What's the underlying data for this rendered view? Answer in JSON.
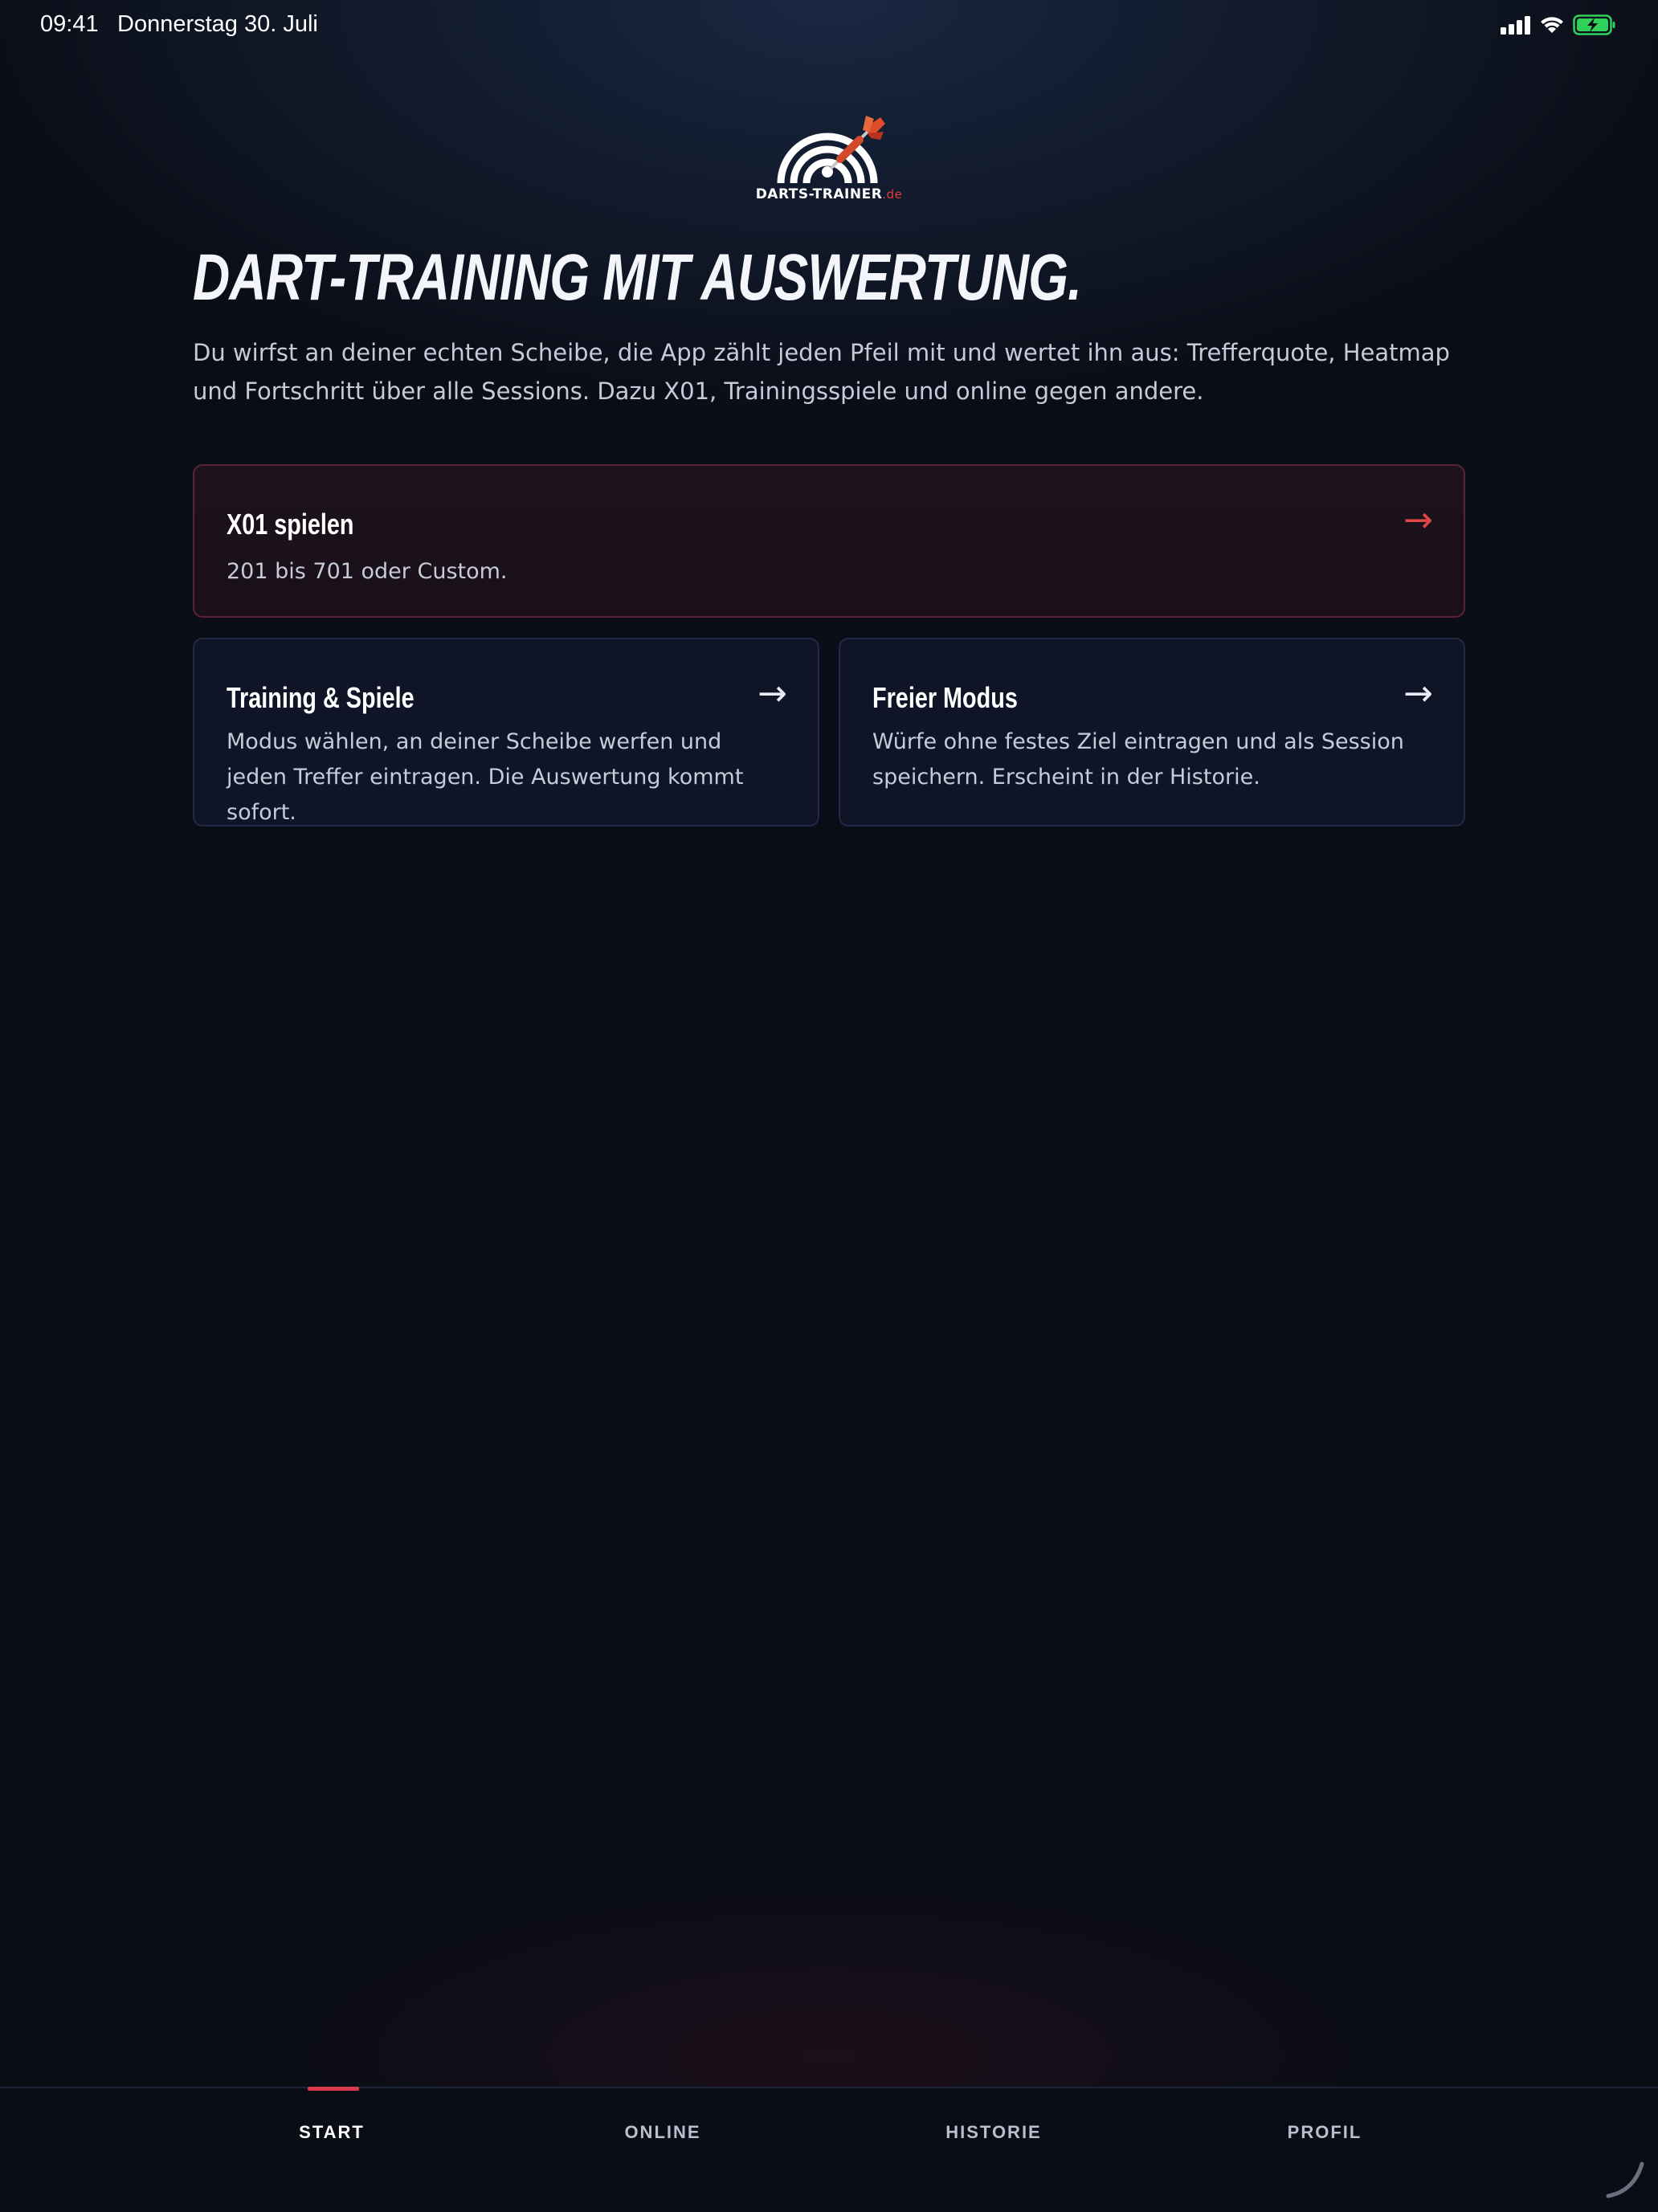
{
  "status_bar": {
    "time": "09:41",
    "date": "Donnerstag 30. Juli",
    "icons": [
      "cellular-signal-icon",
      "wifi-icon",
      "battery-charging-icon"
    ],
    "battery_color": "#30d158"
  },
  "logo": {
    "name": "DARTS-TRAINER",
    "tld": ".de",
    "icon": "dartboard-dart-icon"
  },
  "hero": {
    "title": "DART-TRAINING MIT AUSWERTUNG.",
    "description": "Du wirfst an deiner echten Scheibe, die App zählt jeden Pfeil mit und wertet ihn aus: Trefferquote, Heatmap und Fortschritt über alle Sessions. Dazu X01, Trainingsspiele und online gegen andere."
  },
  "cards": {
    "x01": {
      "title": "X01 spielen",
      "description": "201 bis 701 oder Custom.",
      "arrow": "→"
    },
    "training": {
      "title": "Training & Spiele",
      "description": "Modus wählen, an deiner Scheibe werfen und jeden Treffer eintragen. Die Auswertung kommt sofort.",
      "arrow": "→"
    },
    "free": {
      "title": "Freier Modus",
      "description": "Würfe ohne festes Ziel eintragen und als Session speichern. Erscheint in der Historie.",
      "arrow": "→"
    }
  },
  "nav": {
    "items": [
      {
        "label": "START",
        "active": true
      },
      {
        "label": "ONLINE",
        "active": false
      },
      {
        "label": "HISTORIE",
        "active": false
      },
      {
        "label": "PROFIL",
        "active": false
      }
    ]
  },
  "colors": {
    "accent": "#d93b4a",
    "background": "#0a0d16",
    "card": "#0f1527"
  }
}
